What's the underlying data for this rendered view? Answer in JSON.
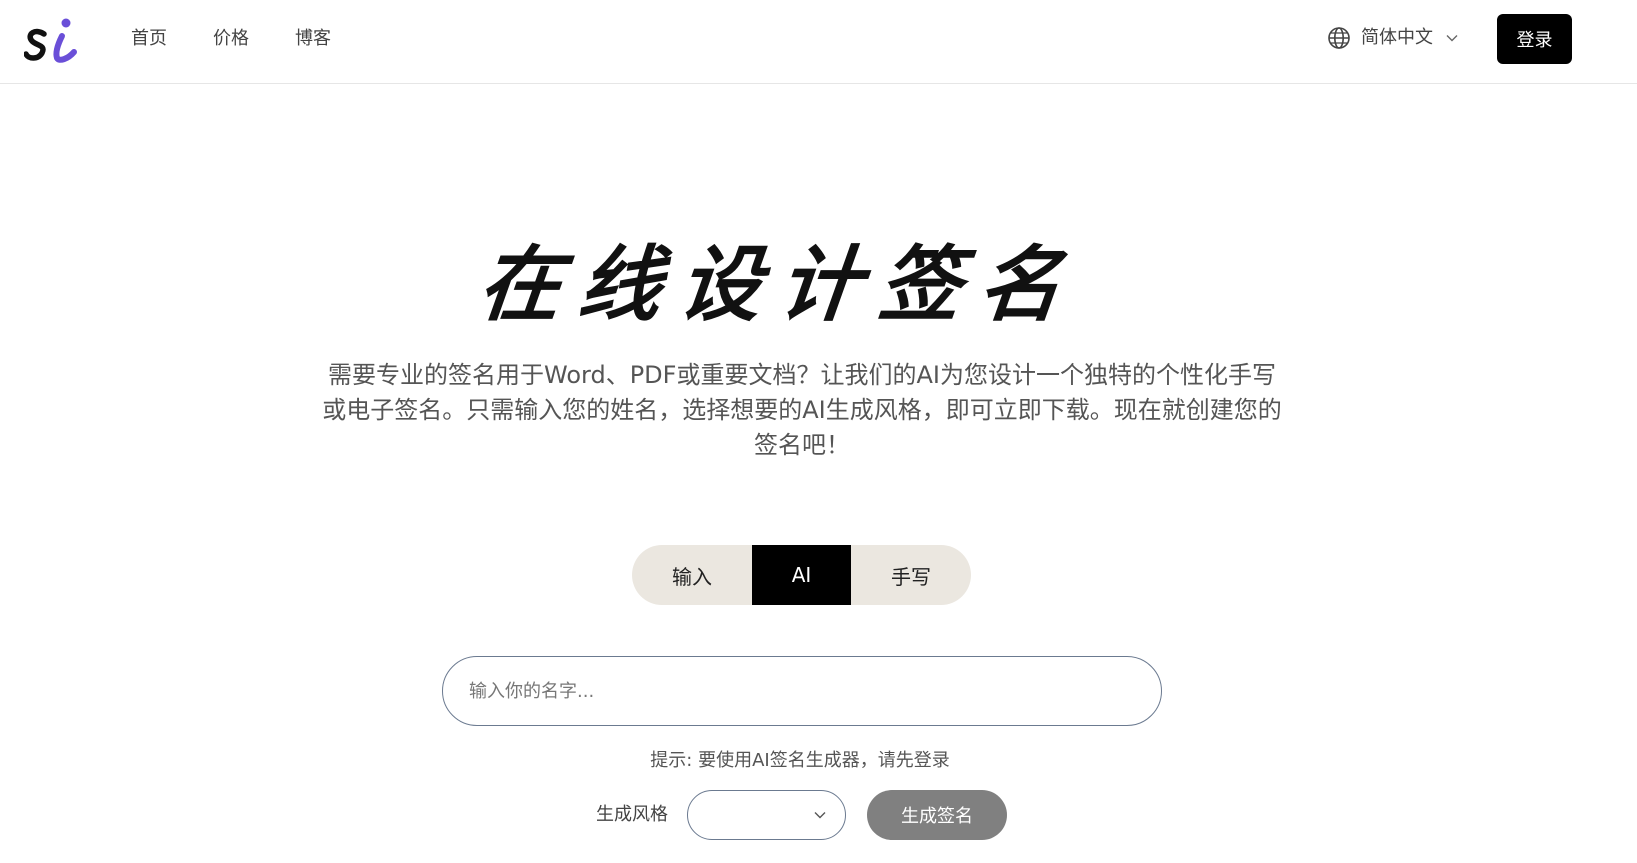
{
  "header": {
    "logo_text": "si",
    "nav": [
      {
        "label": "首页"
      },
      {
        "label": "价格"
      },
      {
        "label": "博客"
      }
    ],
    "language": "简体中文",
    "login_label": "登录"
  },
  "hero": {
    "title": "在线设计签名",
    "description": "需要专业的签名用于Word、PDF或重要文档？让我们的AI为您设计一个独特的个性化手写或电子签名。只需输入您的姓名，选择想要的AI生成风格，即可立即下载。现在就创建您的签名吧！"
  },
  "tabs": [
    {
      "label": "输入"
    },
    {
      "label": "AI"
    },
    {
      "label": "手写"
    }
  ],
  "name_input": {
    "placeholder": "输入你的名字...",
    "value": ""
  },
  "hint": "提示: 要使用AI签名生成器，请先登录",
  "generator": {
    "style_label": "生成风格",
    "style_value": "",
    "generate_label": "生成签名"
  },
  "colors": {
    "accent": "#000000",
    "logo_purple": "#6a4fd8",
    "tab_bg": "#ebe7e0",
    "disabled_button": "#808080"
  }
}
